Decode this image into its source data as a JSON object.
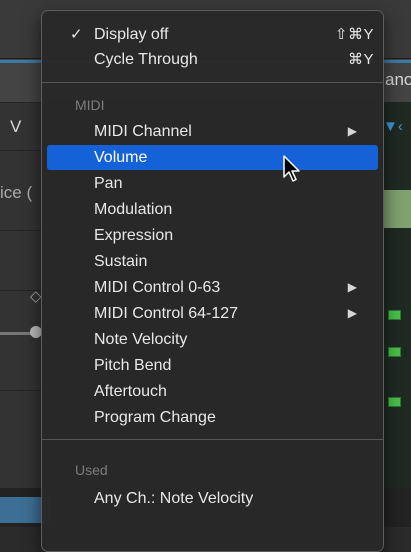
{
  "background": {
    "left_letter_v": "V",
    "left_text_ice": "ice (",
    "right_text_ano": "ano"
  },
  "menu": {
    "top_items": [
      {
        "label": "Display off",
        "checked": true,
        "shortcut": "⇧⌘Y"
      },
      {
        "label": "Cycle Through",
        "checked": false,
        "shortcut": "⌘Y"
      }
    ],
    "midi_header": "MIDI",
    "midi_items": [
      {
        "label": "MIDI Channel",
        "submenu": true
      },
      {
        "label": "Volume",
        "highlighted": true
      },
      {
        "label": "Pan"
      },
      {
        "label": "Modulation"
      },
      {
        "label": "Expression"
      },
      {
        "label": "Sustain"
      },
      {
        "label": "MIDI Control 0-63",
        "submenu": true
      },
      {
        "label": "MIDI Control 64-127",
        "submenu": true
      },
      {
        "label": "Note Velocity"
      },
      {
        "label": "Pitch Bend"
      },
      {
        "label": "Aftertouch"
      },
      {
        "label": "Program Change"
      }
    ],
    "used_header": "Used",
    "used_items": [
      {
        "label": "Any Ch.: Note Velocity"
      }
    ]
  },
  "colors": {
    "highlight": "#1461d8",
    "menu_bg": "#282828",
    "header_text": "#7c7c7c"
  },
  "icons": {
    "check": "✓",
    "submenu": "▶",
    "cursor": "arrow-cursor-icon"
  }
}
